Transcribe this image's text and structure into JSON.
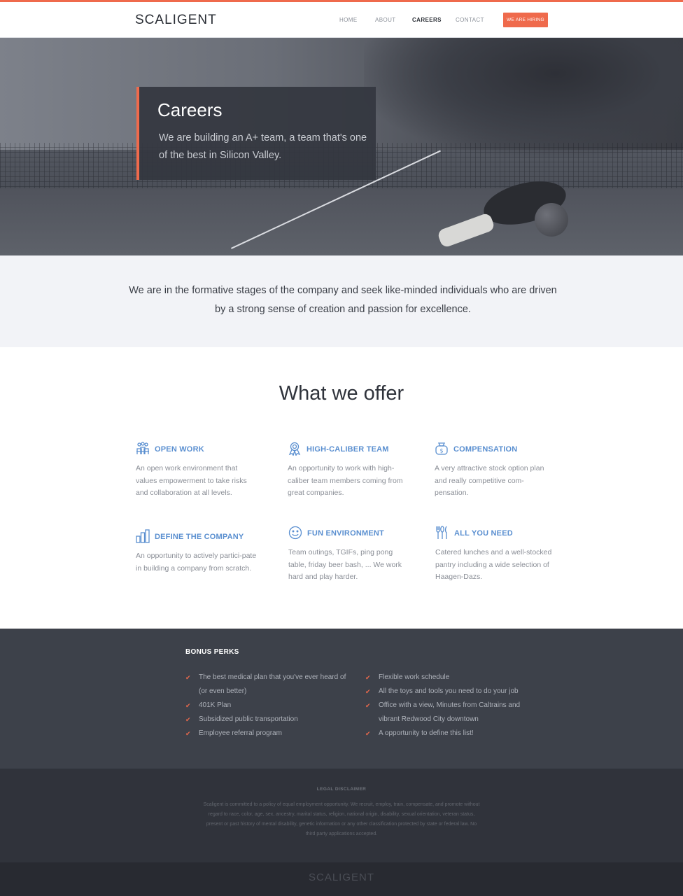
{
  "brand": {
    "logo": "SCALIGENT",
    "accent": "#ef6a4c"
  },
  "nav": {
    "items": [
      {
        "label": "HOME"
      },
      {
        "label": "ABOUT"
      },
      {
        "label": "CAREERS",
        "active": true
      },
      {
        "label": "CONTACT"
      }
    ],
    "cta": "WE ARE HIRING"
  },
  "hero": {
    "title": "Careers",
    "subtitle": "We are building an A+ team, a team that's one of the best in Silicon Valley."
  },
  "intro": {
    "text": "We are in the formative stages of the company and seek like-minded individuals who are driven by a strong sense of creation and passion for excellence."
  },
  "offers": {
    "heading": "What we offer",
    "items": [
      {
        "icon": "people-icon",
        "title": "OPEN WORK",
        "text": "An open work environment that values empowerment to take risks and collaboration at all levels."
      },
      {
        "icon": "award-ribbon-icon",
        "title": "HIGH-CALIBER TEAM",
        "text": "An opportunity to work with high-caliber team members coming from great companies."
      },
      {
        "icon": "money-bag-icon",
        "title": "COMPENSATION",
        "text": "A very attractive stock option plan and really competitive com-pensation."
      },
      {
        "icon": "bar-chart-icon",
        "title": "DEFINE THE COMPANY",
        "text": "An opportunity to actively partici-pate in building a company from scratch."
      },
      {
        "icon": "smiley-icon",
        "title": "FUN ENVIRONMENT",
        "text": "Team outings, TGIFs, ping pong table, friday beer bash, ... We work hard and play harder."
      },
      {
        "icon": "utensils-icon",
        "title": "ALL YOU NEED",
        "text": "Catered lunches and a well-stocked pantry including a wide selection of Haagen-Dazs."
      }
    ]
  },
  "perks": {
    "title": "BONUS PERKS",
    "left": [
      "The best medical plan that you've ever heard of (or even better)",
      "401K Plan",
      "Subsidized public transportation",
      "Employee referral program"
    ],
    "right": [
      "Flexible work schedule",
      "All the toys and tools you need to do your job",
      "Office with a view, Minutes from Caltrains and vibrant Redwood City downtown",
      "A opportunity to define this list!"
    ]
  },
  "legal": {
    "title": "LEGAL DISCLAIMER",
    "text": "Scaligent is committed to a policy of equal employment opportunity. We recruit, employ, train, compensate, and promote without regard to race, color, age, sex, ancestry, marital status, religion, national origin, disability, sexual orientation, veteran status, present or past history of mental disability, genetic information or any other classification protected by state or federal law. No third party applications accepted."
  },
  "footer": {
    "logo": "SCALIGENT"
  }
}
